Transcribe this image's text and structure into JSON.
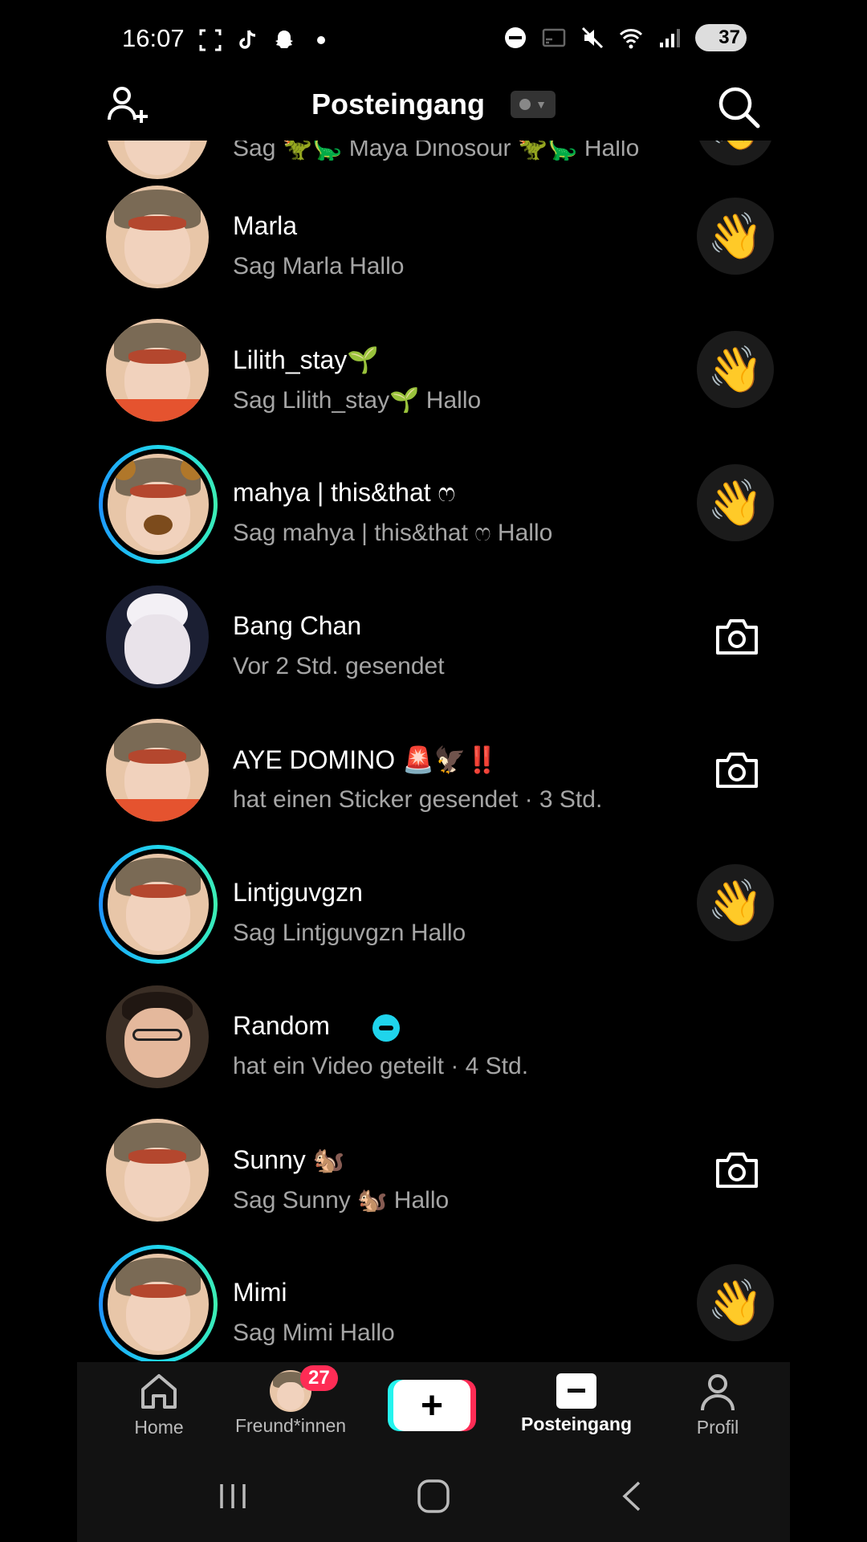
{
  "status_bar": {
    "time": "16:07",
    "left_icons": [
      "screenshot-frame",
      "tiktok",
      "snapchat",
      "dot"
    ],
    "right_icons": [
      "do-not-disturb",
      "cast",
      "mute",
      "wifi",
      "signal"
    ],
    "battery": "37"
  },
  "header": {
    "title": "Posteingang",
    "add_friend_icon": "person-plus-icon",
    "search_icon": "search-icon"
  },
  "conversations": [
    {
      "name": "",
      "subtitle": "Sag 🦖🦕 Maya Dinosour 🦖🦕 Hallo",
      "action": "wave",
      "ring": false,
      "avatar": "boy-cap"
    },
    {
      "name": "Marla",
      "subtitle": "Sag Marla Hallo",
      "action": "wave",
      "ring": false,
      "avatar": "boy-cap"
    },
    {
      "name": "Lilith_stay🌱",
      "subtitle": "Sag Lilith_stay🌱 Hallo",
      "action": "wave",
      "ring": false,
      "avatar": "boy-cap-red"
    },
    {
      "name": "mahya | this&that ෆ",
      "subtitle": "Sag mahya | this&that ෆ Hallo",
      "action": "wave",
      "ring": true,
      "avatar": "boy-bear"
    },
    {
      "name": "Bang Chan",
      "subtitle": "Vor 2 Std. gesendet",
      "action": "camera",
      "ring": false,
      "avatar": "blonde"
    },
    {
      "name": "AYE DOMINO 🚨🦅‼️",
      "subtitle": "hat einen Sticker gesendet · 3 Std.",
      "action": "camera",
      "ring": false,
      "avatar": "boy-cap-red"
    },
    {
      "name": "Lintjguvgzn",
      "subtitle": "Sag Lintjguvgzn Hallo",
      "action": "wave",
      "ring": true,
      "avatar": "boy-cap"
    },
    {
      "name": "Random",
      "subtitle": "hat ein Video geteilt  · 4 Std.",
      "action": "none",
      "ring": false,
      "avatar": "random"
    },
    {
      "name": "Sunny 🐿️",
      "subtitle": "Sag Sunny 🐿️ Hallo",
      "action": "camera",
      "ring": false,
      "avatar": "boy-cap"
    },
    {
      "name": "Mimi",
      "subtitle": "Sag Mimi Hallo",
      "action": "wave",
      "ring": true,
      "avatar": "boy-cap"
    }
  ],
  "wave_glyph": "👋",
  "bottom_nav": {
    "home": "Home",
    "friends": "Freund*innen",
    "friends_badge": "27",
    "create": "+",
    "inbox": "Posteingang",
    "profile": "Profil"
  },
  "colors": {
    "background": "#000000",
    "accent_red": "#fe2c55",
    "accent_cyan": "#25f4ee",
    "subtitle_gray": "#a5a5a5"
  }
}
